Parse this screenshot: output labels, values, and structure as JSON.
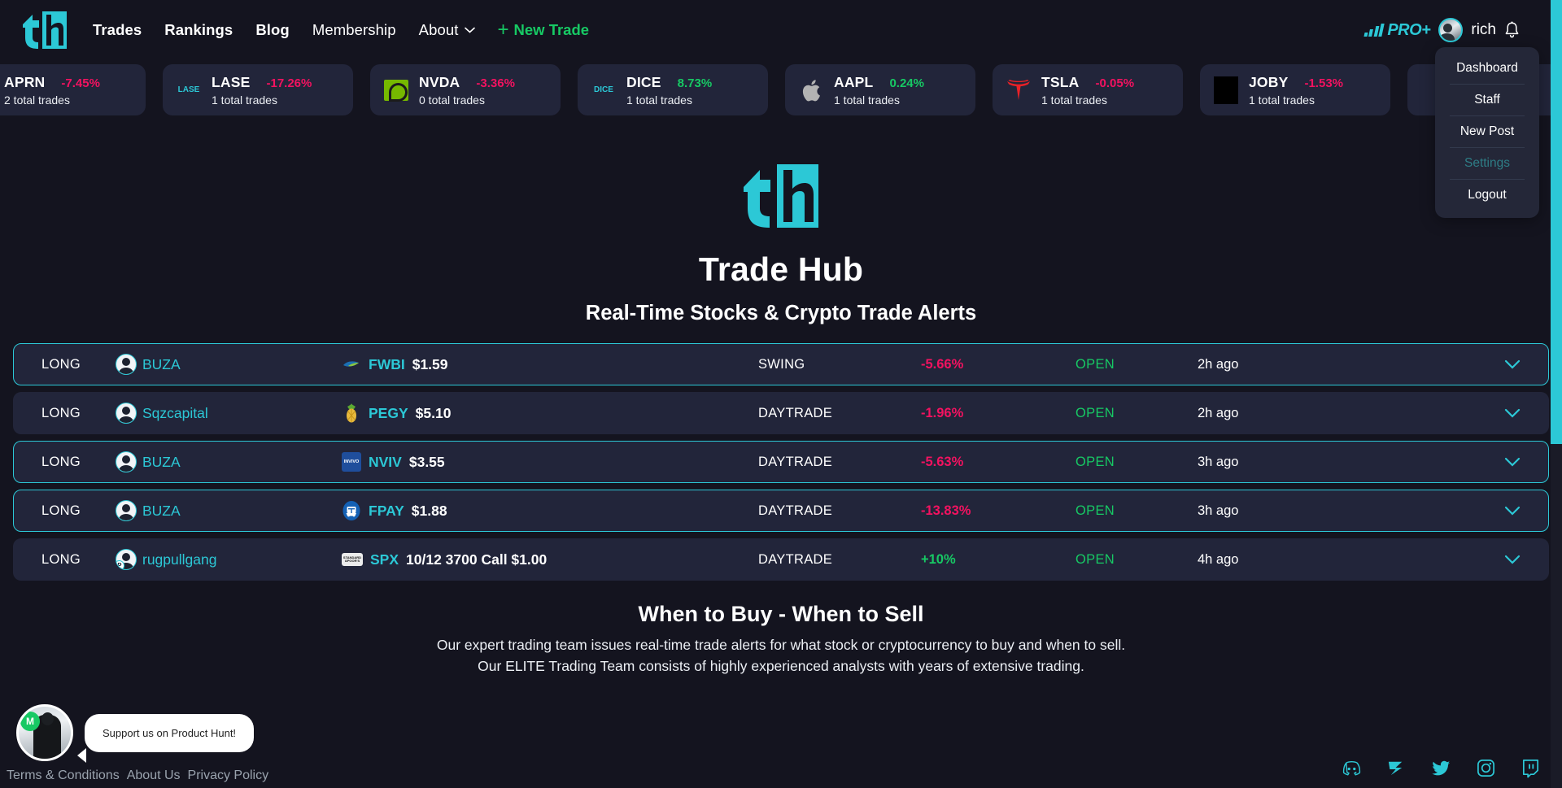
{
  "brand": {
    "name": "Trade Hub",
    "logo_text": "th",
    "accent": "#2cc8d6"
  },
  "header": {
    "nav": [
      {
        "label": "Trades",
        "bold": true
      },
      {
        "label": "Rankings",
        "bold": true
      },
      {
        "label": "Blog",
        "bold": true
      },
      {
        "label": "Membership",
        "bold": false
      },
      {
        "label": "About",
        "bold": false,
        "caret": true
      }
    ],
    "new_trade_label": "New Trade",
    "plus": "+",
    "pro_badge": "PRO+",
    "username": "rich",
    "bell_icon": "bell-icon"
  },
  "user_menu": {
    "items": [
      {
        "label": "Dashboard",
        "muted": false
      },
      {
        "label": "Staff",
        "muted": false
      },
      {
        "label": "New Post",
        "muted": false
      },
      {
        "label": "Settings",
        "muted": true
      },
      {
        "label": "Logout",
        "muted": false
      }
    ]
  },
  "tickers": [
    {
      "symbol": "APRN",
      "change": "-7.45%",
      "dir": "down",
      "trades": "2 total trades",
      "logo": "none"
    },
    {
      "symbol": "LASE",
      "change": "-17.26%",
      "dir": "down",
      "trades": "1 total trades",
      "logo": "lase-text"
    },
    {
      "symbol": "NVDA",
      "change": "-3.36%",
      "dir": "down",
      "trades": "0 total trades",
      "logo": "nvidia"
    },
    {
      "symbol": "DICE",
      "change": "8.73%",
      "dir": "up",
      "trades": "1 total trades",
      "logo": "dice-text"
    },
    {
      "symbol": "AAPL",
      "change": "0.24%",
      "dir": "up",
      "trades": "1 total trades",
      "logo": "apple"
    },
    {
      "symbol": "TSLA",
      "change": "-0.05%",
      "dir": "down",
      "trades": "1 total trades",
      "logo": "tesla"
    },
    {
      "symbol": "JOBY",
      "change": "-1.53%",
      "dir": "down",
      "trades": "1 total trades",
      "logo": "joby"
    }
  ],
  "hero": {
    "title": "Trade Hub",
    "subtitle": "Real-Time Stocks & Crypto Trade Alerts"
  },
  "trades": {
    "rows": [
      {
        "side": "LONG",
        "user": "BUZA",
        "user_badge": "",
        "symbol": "FWBI",
        "price": "$1.59",
        "type": "SWING",
        "pct": "-5.66%",
        "dir": "down",
        "status": "OPEN",
        "time": "2h ago",
        "highlighted": true,
        "logo": "fwbi"
      },
      {
        "side": "LONG",
        "user": "Sqzcapital",
        "user_badge": "",
        "symbol": "PEGY",
        "price": "$5.10",
        "type": "DAYTRADE",
        "pct": "-1.96%",
        "dir": "down",
        "status": "OPEN",
        "time": "2h ago",
        "highlighted": false,
        "logo": "pegy"
      },
      {
        "side": "LONG",
        "user": "BUZA",
        "user_badge": "",
        "symbol": "NVIV",
        "price": "$3.55",
        "type": "DAYTRADE",
        "pct": "-5.63%",
        "dir": "down",
        "status": "OPEN",
        "time": "3h ago",
        "highlighted": true,
        "logo": "nviv"
      },
      {
        "side": "LONG",
        "user": "BUZA",
        "user_badge": "",
        "symbol": "FPAY",
        "price": "$1.88",
        "type": "DAYTRADE",
        "pct": "-13.83%",
        "dir": "down",
        "status": "OPEN",
        "time": "3h ago",
        "highlighted": true,
        "logo": "fpay"
      },
      {
        "side": "LONG",
        "user": "rugpullgang",
        "user_badge": "P",
        "symbol": "SPX",
        "price": "10/12 3700 Call $1.00",
        "type": "DAYTRADE",
        "pct": "+10%",
        "dir": "up",
        "status": "OPEN",
        "time": "4h ago",
        "highlighted": false,
        "logo": "spx"
      }
    ]
  },
  "bottom": {
    "title": "When to Buy - When to Sell",
    "line1": "Our expert trading team issues real-time trade alerts for what stock or cryptocurrency to buy and when to sell.",
    "line2": "Our ELITE Trading Team consists of highly experienced analysts with years of extensive trading."
  },
  "product_hunt": {
    "message": "Support us on Product Hunt!",
    "badge": "M"
  },
  "footer": {
    "links": [
      "Terms & Conditions",
      "About Us",
      "Privacy Policy"
    ],
    "socials": [
      "discord-icon",
      "stocktwits-icon",
      "twitter-icon",
      "instagram-icon",
      "twitch-icon"
    ]
  },
  "colors": {
    "up": "#17c964",
    "down": "#f31260",
    "accent": "#2cc8d6",
    "bg": "#14141f",
    "card": "#22253a"
  }
}
